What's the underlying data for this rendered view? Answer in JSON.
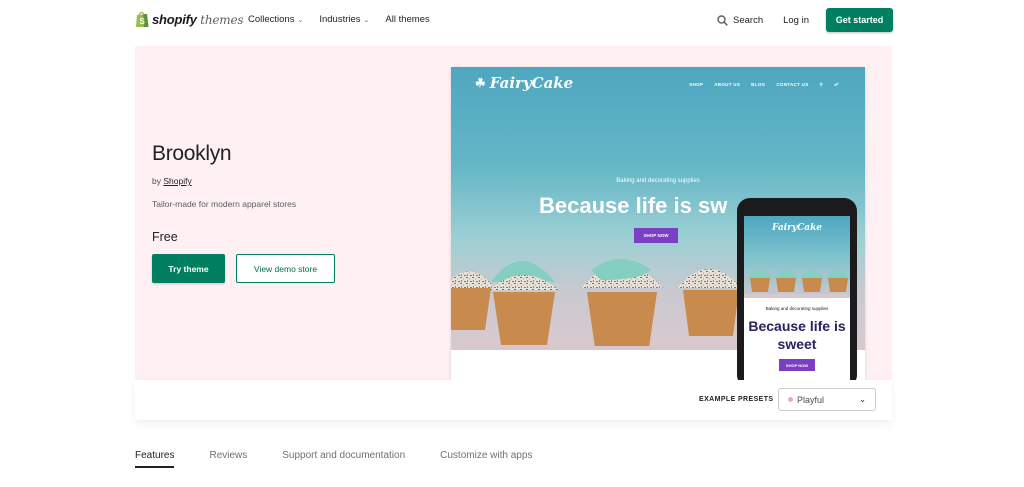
{
  "header": {
    "logo_brand": "shopify",
    "logo_suffix": "themes",
    "nav": [
      {
        "label": "Collections",
        "dropdown": true
      },
      {
        "label": "Industries",
        "dropdown": true
      },
      {
        "label": "All themes",
        "dropdown": false
      }
    ],
    "search_label": "Search",
    "login_label": "Log in",
    "cta_label": "Get started"
  },
  "hero": {
    "title": "Brooklyn",
    "by_prefix": "by",
    "author": "Shopify",
    "tagline": "Tailor-made for modern apparel stores",
    "price": "Free",
    "try_label": "Try theme",
    "demo_label": "View demo store",
    "preview": {
      "store_name": "FairyCake",
      "nav": [
        "SHOP",
        "ABOUT US",
        "BLOG",
        "CONTACT US"
      ],
      "subtitle": "Baking and decorating supplies",
      "headline_partial": "Because life is sw",
      "shop_now": "SHOP NOW",
      "mobile_headline": "Because life is sweet"
    }
  },
  "presets": {
    "label": "EXAMPLE PRESETS",
    "selected": "Playful"
  },
  "tabs": [
    {
      "label": "Features",
      "active": true
    },
    {
      "label": "Reviews",
      "active": false
    },
    {
      "label": "Support and documentation",
      "active": false
    },
    {
      "label": "Customize with apps",
      "active": false
    }
  ],
  "colors": {
    "brand_green": "#008060",
    "hero_bg": "#fff0f3",
    "preview_button": "#7b3fc4"
  }
}
